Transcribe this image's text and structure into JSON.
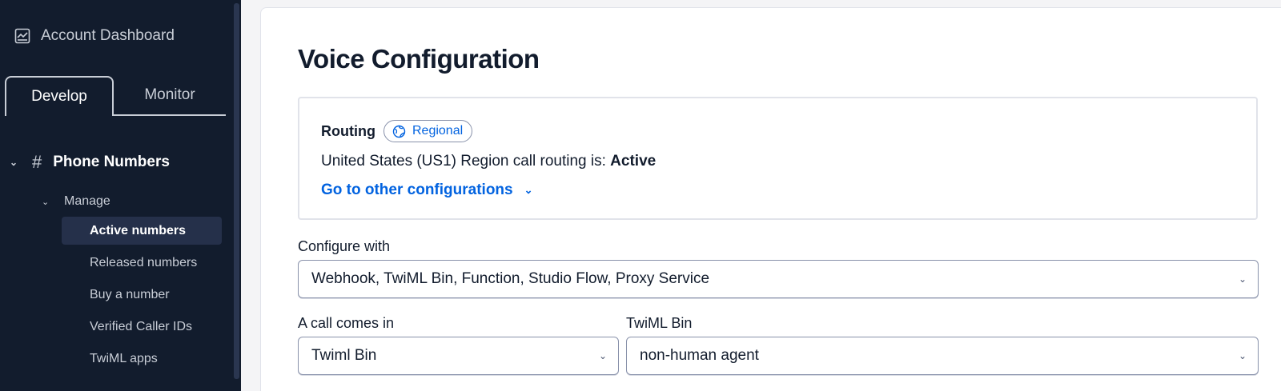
{
  "sidebar": {
    "dashboard_label": "Account Dashboard",
    "tabs": [
      {
        "label": "Develop",
        "active": true
      },
      {
        "label": "Monitor",
        "active": false
      }
    ],
    "section": {
      "label": "Phone Numbers",
      "icon": "hash-icon"
    },
    "subsection": {
      "label": "Manage"
    },
    "items": [
      {
        "label": "Active numbers",
        "active": true
      },
      {
        "label": "Released numbers",
        "active": false
      },
      {
        "label": "Buy a number",
        "active": false
      },
      {
        "label": "Verified Caller IDs",
        "active": false
      },
      {
        "label": "TwiML apps",
        "active": false
      }
    ]
  },
  "main": {
    "title": "Voice Configuration",
    "routing": {
      "label": "Routing",
      "badge": "Regional",
      "status_prefix": "United States (US1) Region call routing is: ",
      "status_value": "Active",
      "link": "Go to other configurations"
    },
    "configure_with": {
      "label": "Configure with",
      "value": "Webhook, TwiML Bin, Function, Studio Flow, Proxy Service"
    },
    "call_comes_in": {
      "label": "A call comes in",
      "value": "Twiml Bin"
    },
    "twiml_bin": {
      "label": "TwiML Bin",
      "value": "non-human agent"
    }
  },
  "colors": {
    "sidebar_bg": "#121c2d",
    "link": "#0263e0",
    "text": "#121c2d"
  }
}
